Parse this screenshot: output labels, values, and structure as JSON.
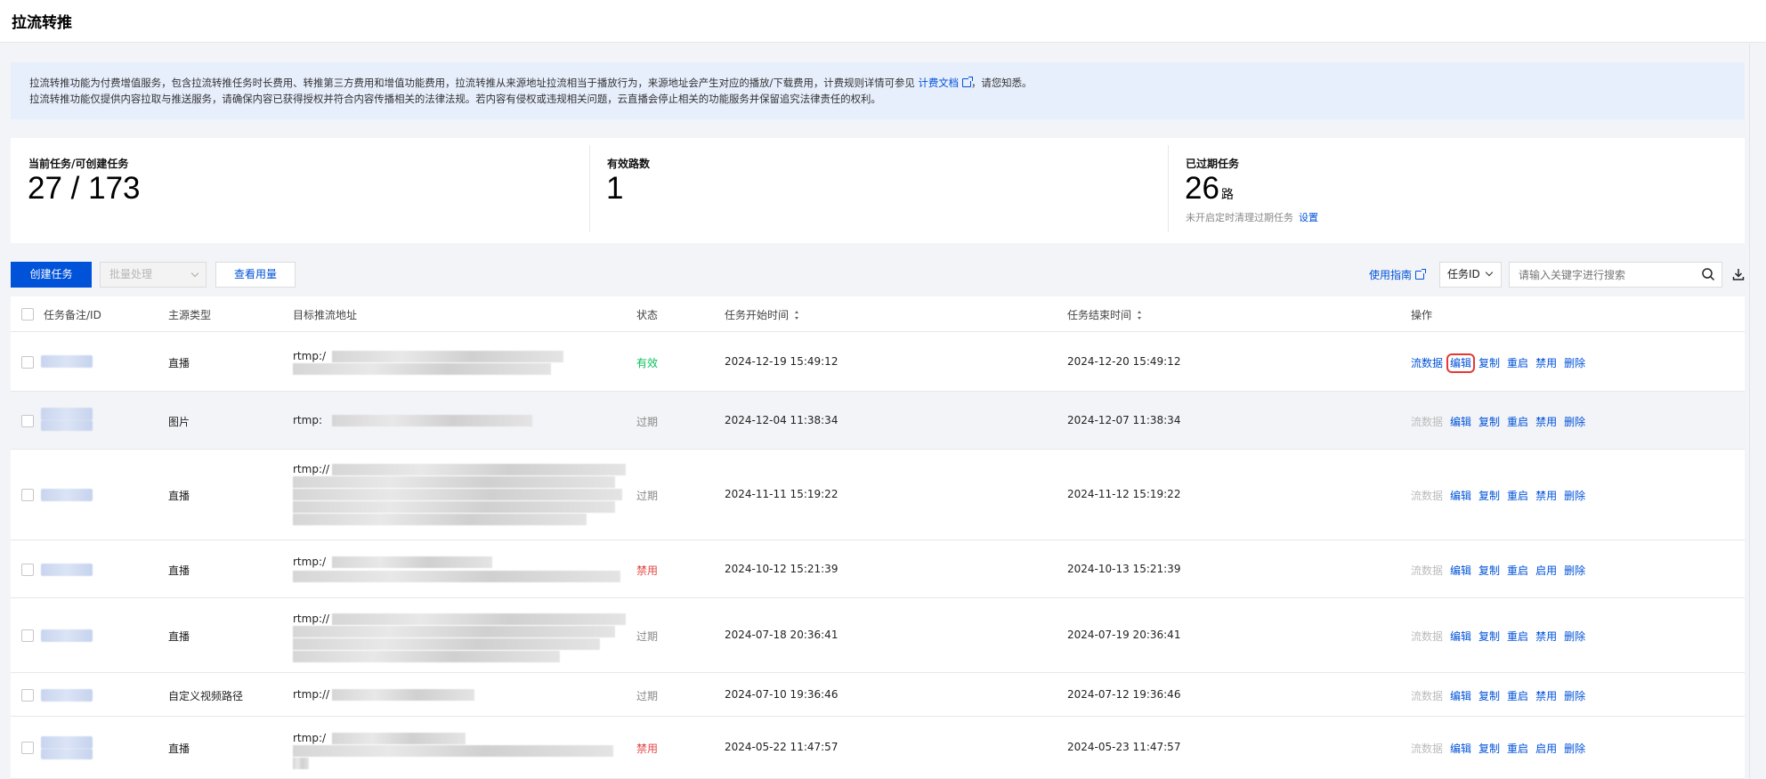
{
  "page": {
    "title": "拉流转推"
  },
  "notice": {
    "line1_pre": "拉流转推功能为付费增值服务，包含拉流转推任务时长费用、转推第三方费用和增值功能费用，拉流转推从来源地址拉流相当于播放行为，来源地址会产生对应的播放/下载费用，计费规则详情可参见",
    "line1_link": "计费文档",
    "line1_post": "，请您知悉。",
    "line2": "拉流转推功能仅提供内容拉取与推送服务，请确保内容已获得授权并符合内容传播相关的法律法规。若内容有侵权或违规相关问题，云直播会停止相关的功能服务并保留追究法律责任的权利。"
  },
  "stats": {
    "current": {
      "label": "当前任务/可创建任务",
      "value": "27 / 173"
    },
    "valid": {
      "label": "有效路数",
      "value": "1"
    },
    "expired": {
      "label": "已过期任务",
      "value": "26",
      "unit": "路",
      "sub": "未开启定时清理过期任务",
      "link": "设置"
    }
  },
  "toolbar": {
    "create": "创建任务",
    "batch": "批量处理",
    "usage": "查看用量",
    "guide": "使用指南",
    "field": "任务ID",
    "search_placeholder": "请输入关键字进行搜索"
  },
  "table": {
    "headers": {
      "id": "任务备注/ID",
      "source": "主源类型",
      "target": "目标推流地址",
      "status": "状态",
      "start": "任务开始时间",
      "end": "任务结束时间",
      "ops": "操作"
    },
    "rows": [
      {
        "source": "直播",
        "url_prefix": "rtmp:/",
        "status": "有效",
        "start": "2024-12-19 15:49:12",
        "end": "2024-12-20 15:49:12",
        "toggle": "禁用"
      },
      {
        "source": "图片",
        "url_prefix": "rtmp:",
        "status": "过期",
        "start": "2024-12-04 11:38:34",
        "end": "2024-12-07 11:38:34",
        "toggle": "禁用"
      },
      {
        "source": "直播",
        "url_prefix": "rtmp://",
        "status": "过期",
        "start": "2024-11-11 15:19:22",
        "end": "2024-11-12 15:19:22",
        "toggle": "禁用"
      },
      {
        "source": "直播",
        "url_prefix": "rtmp:/",
        "status": "禁用",
        "start": "2024-10-12 15:21:39",
        "end": "2024-10-13 15:21:39",
        "toggle": "启用"
      },
      {
        "source": "直播",
        "url_prefix": "rtmp://",
        "status": "过期",
        "start": "2024-07-18 20:36:41",
        "end": "2024-07-19 20:36:41",
        "toggle": "禁用"
      },
      {
        "source": "自定义视频路径",
        "url_prefix": "rtmp://",
        "status": "过期",
        "start": "2024-07-10 19:36:46",
        "end": "2024-07-12 19:36:46",
        "toggle": "禁用"
      },
      {
        "source": "直播",
        "url_prefix": "rtmp:/",
        "status": "禁用",
        "start": "2024-05-22 11:47:57",
        "end": "2024-05-23 11:47:57",
        "toggle": "启用"
      }
    ],
    "ops": {
      "stream": "流数据",
      "edit": "编辑",
      "copy": "复制",
      "restart": "重启",
      "delete": "删除"
    }
  }
}
